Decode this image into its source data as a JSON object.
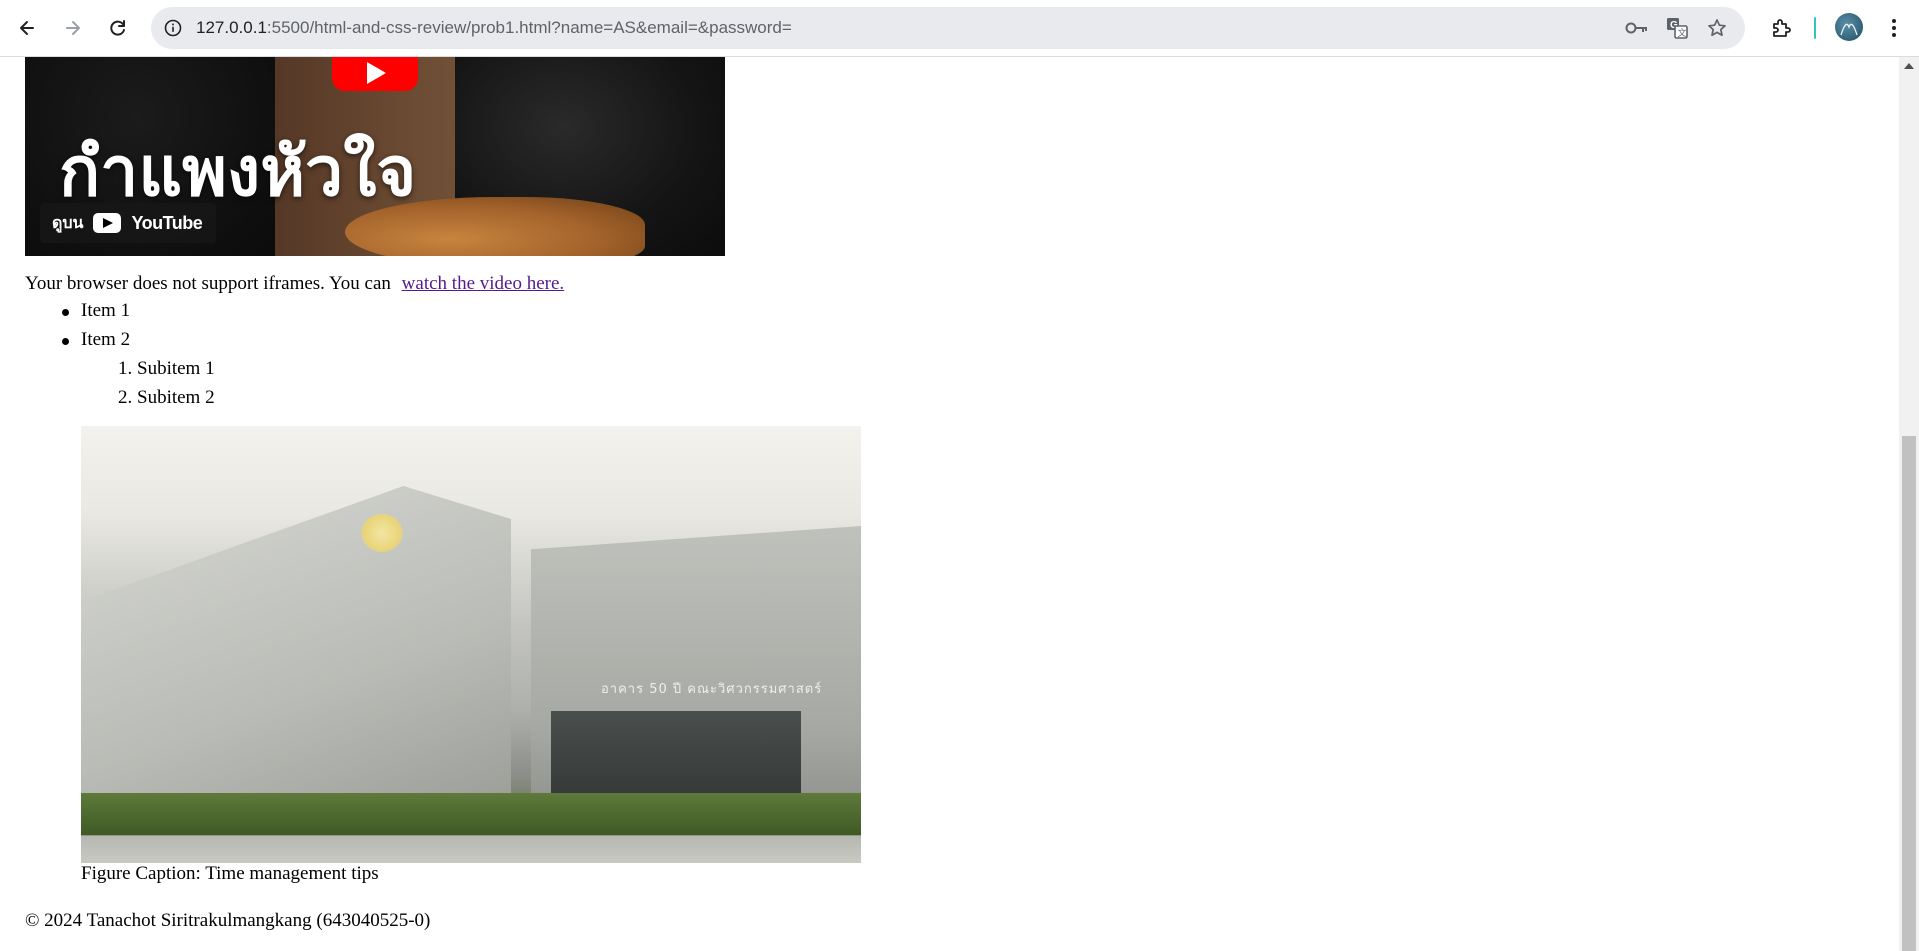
{
  "browser": {
    "url_host": "127.0.0.1",
    "url_rest": ":5500/html-and-css-review/prob1.html?name=AS&email=&password=",
    "icons": {
      "back": "arrow-left-icon",
      "forward": "arrow-right-icon",
      "reload": "reload-icon",
      "site_info": "info-icon",
      "password": "key-icon",
      "translate": "translate-icon",
      "bookmark": "star-icon",
      "extensions": "puzzle-icon",
      "menu": "kebab-menu-icon"
    },
    "accent_divider_color": "#34c3bf"
  },
  "video": {
    "title_overlay": "กำแพงหัวใจ",
    "watch_on_label": "ดูบน",
    "youtube_label": "YouTube",
    "play_color": "#ff0000"
  },
  "iframe_fallback": {
    "text": "Your browser does not support iframes. You can",
    "link_text": "watch the video here.",
    "link_color": "#551a8b"
  },
  "list": {
    "items": [
      "Item 1",
      "Item 2"
    ],
    "subitems": [
      "Subitem 1",
      "Subitem 2"
    ],
    "subitem_markers": [
      "1.",
      "2."
    ]
  },
  "figure": {
    "building_sign": "อาคาร 50 ปี คณะวิศวกรรมศาสตร์",
    "caption": "Figure Caption: Time management tips"
  },
  "footer": {
    "text": "© 2024 Tanachot Siritrakulmangkang (643040525-0)"
  }
}
